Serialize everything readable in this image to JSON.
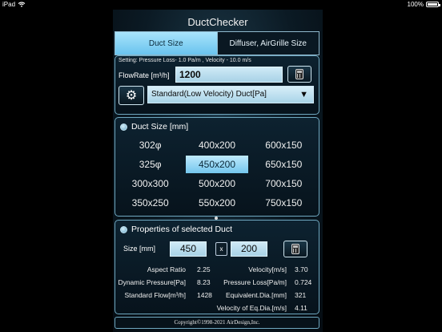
{
  "status": {
    "device": "iPad",
    "time": "",
    "battery": "100%",
    "battery_level": 1.0
  },
  "app": {
    "title": "DuctChecker"
  },
  "tabs": [
    {
      "label": "Duct Size",
      "active": true
    },
    {
      "label": "Diffuser, AirGrille Size",
      "active": false
    }
  ],
  "input_panel": {
    "setting_text": "Setting: Pressure Loss-   1.0 Pa/m , Velocity -  10.0 m/s",
    "flow_label": "FlowRate [m³/h]",
    "flow_value": "1200",
    "duct_type": "Standard(Low Velocity) Duct[Pa]",
    "duct_type_arrow": "▼",
    "gear_glyph": "⚙"
  },
  "duct_sizes": {
    "header": "Duct Size [mm]",
    "selected": "450x200",
    "items": [
      "302φ",
      "400x200",
      "600x150",
      "325φ",
      "450x200",
      "650x150",
      "300x300",
      "500x200",
      "700x150",
      "350x250",
      "550x200",
      "750x150"
    ]
  },
  "properties": {
    "header": "Properties of selected Duct",
    "size_label": "Size [mm]",
    "width": "450",
    "height": "200",
    "times": "x",
    "left": [
      {
        "label": "Aspect Ratio",
        "value": "2.25"
      },
      {
        "label": "Dynamic Pressure[Pa]",
        "value": "8.23"
      },
      {
        "label": "Standard Flow[m³/h]",
        "value": "1428"
      }
    ],
    "right": [
      {
        "label": "Velocity[m/s]",
        "value": "3.70"
      },
      {
        "label": "Pressure Loss[Pa/m]",
        "value": "0.724"
      },
      {
        "label": "Equivalent.Dia.[mm]",
        "value": "321"
      },
      {
        "label": "Velocity of Eq.Dia.[m/s]",
        "value": "4.11"
      }
    ]
  },
  "footer": {
    "copyright": "Copyright©1998-2021 AirDesign,Inc."
  }
}
